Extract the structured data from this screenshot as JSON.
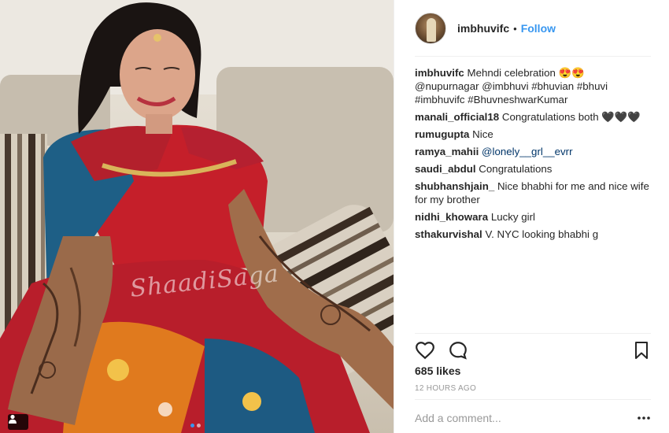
{
  "post": {
    "username": "imbhuvifc",
    "separator": "•",
    "follow_label": "Follow",
    "watermark": "ShaadiSaga",
    "likes": "685 likes",
    "timestamp": "12 HOURS AGO",
    "comment_placeholder": "Add a comment...",
    "carousel": {
      "total": 2,
      "active": 1
    }
  },
  "caption": {
    "author": "imbhuvifc",
    "text": "Mehndi celebration 😍😍\n@nupurnagar @imbhuvi #bhuvian #bhuvi\n#imbhuvifc #BhuvneshwarKumar"
  },
  "comments": [
    {
      "author": "manali_official18",
      "text": "Congratulations both 🖤🖤🖤"
    },
    {
      "author": "rumugupta",
      "text": "Nice"
    },
    {
      "author": "ramya_mahii",
      "text": "@lonely__grl__evrr"
    },
    {
      "author": "saudi_abdul",
      "text": "Congratulations"
    },
    {
      "author": "shubhanshjain_",
      "text": "Nice bhabhi for me and nice wife for my brother"
    },
    {
      "author": "nidhi_khowara",
      "text": "Lucky girl"
    },
    {
      "author": "sthakurvishal",
      "text": "V. NYC looking bhabhi g"
    }
  ],
  "icons": {
    "like": "heart-icon",
    "comment": "speech-bubble-icon",
    "save": "bookmark-icon",
    "more": "ellipsis-icon",
    "tagged_users": "user-tag-icon"
  },
  "colors": {
    "link": "#3897f0",
    "mention": "#003569",
    "text": "#262626",
    "muted": "#999999"
  }
}
